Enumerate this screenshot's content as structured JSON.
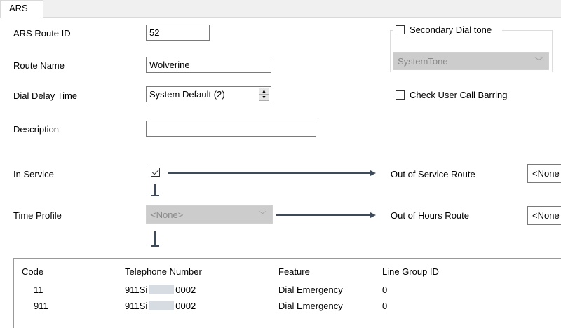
{
  "tabs": [
    {
      "label": "ARS"
    }
  ],
  "form": {
    "route_id_label": "ARS Route ID",
    "route_id_value": "52",
    "route_name_label": "Route Name",
    "route_name_value": "Wolverine",
    "dial_delay_label": "Dial Delay Time",
    "dial_delay_value": "System Default (2)",
    "description_label": "Description",
    "description_value": "",
    "in_service_label": "In Service",
    "in_service_checked": true,
    "time_profile_label": "Time Profile",
    "time_profile_value": "<None>",
    "out_of_service_label": "Out of Service Route",
    "out_of_service_value": "<None",
    "out_of_hours_label": "Out of Hours Route",
    "out_of_hours_value": "<None"
  },
  "secondary": {
    "secondary_dial_tone_label": "Secondary Dial tone",
    "secondary_dial_tone_checked": false,
    "tone_value": "SystemTone",
    "check_barring_label": "Check User Call Barring",
    "check_barring_checked": false
  },
  "table": {
    "headers": [
      "Code",
      "Telephone Number",
      "Feature",
      "Line Group ID"
    ],
    "rows": [
      {
        "code": "11",
        "tel_prefix": "911Si",
        "tel_suffix": "0002",
        "feature": "Dial Emergency",
        "line_group": "0"
      },
      {
        "code": "911",
        "tel_prefix": "911Si",
        "tel_suffix": "0002",
        "feature": "Dial Emergency",
        "line_group": "0"
      }
    ]
  },
  "colors": {
    "disabled_bg": "#cccccc",
    "connector": "#3c4a5a",
    "redaction": "#d7dbe2"
  }
}
